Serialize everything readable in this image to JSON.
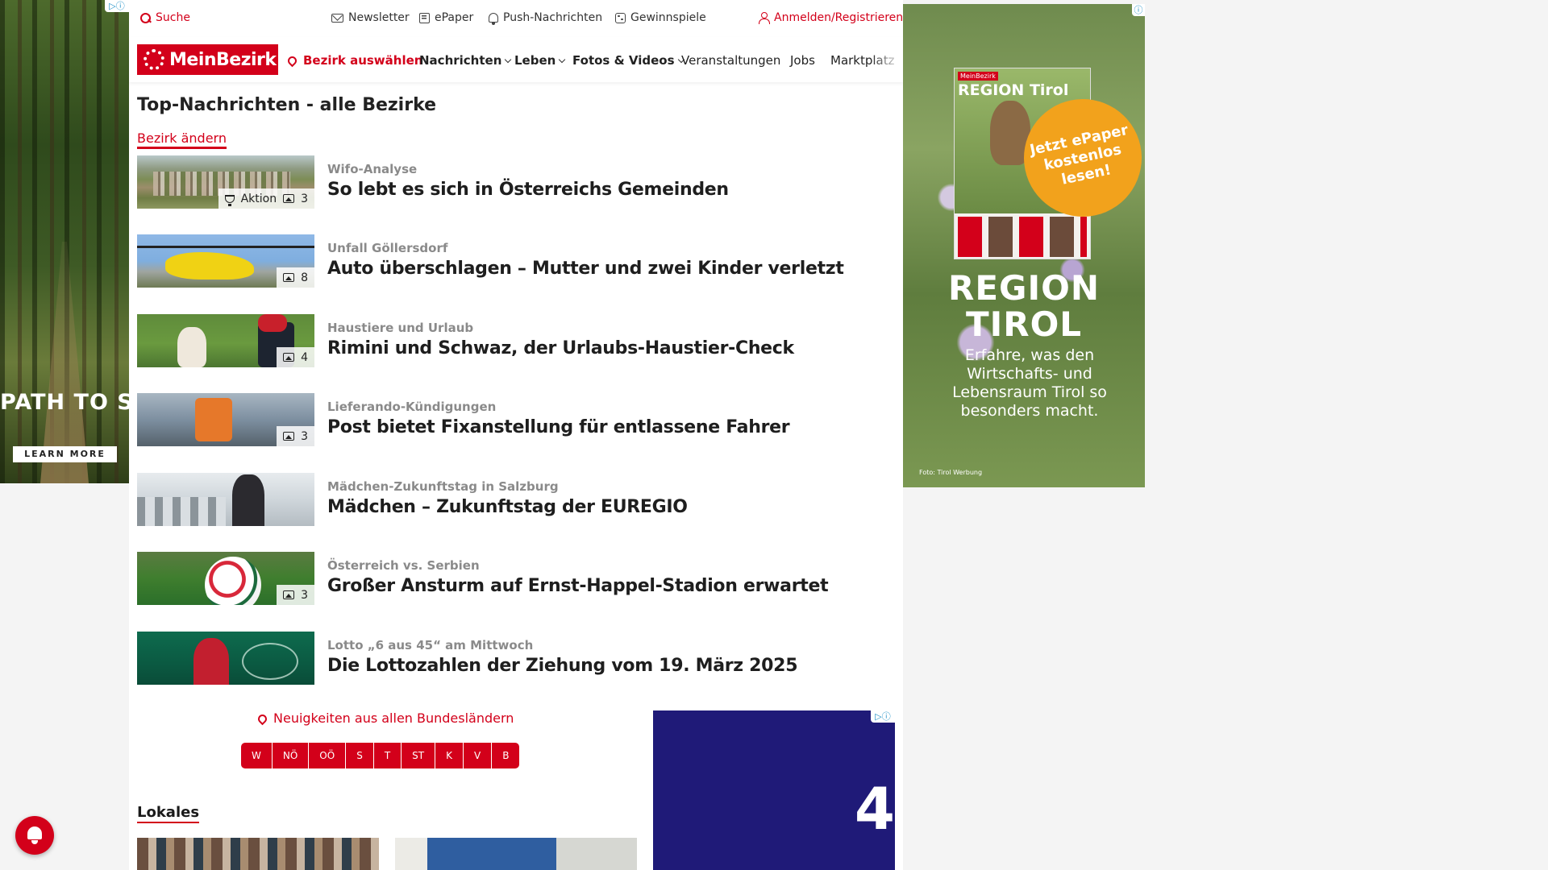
{
  "ads": {
    "left": {
      "headline": "PATH TO SUCCESS",
      "cta": "LEARN MORE",
      "choice": "▷ⓘ"
    },
    "right": {
      "magazine_label": "MeinBezirk",
      "magazine_title": "REGION Tirol",
      "promo": "Jetzt ePaper kostenlos lesen!",
      "headline": "REGION TIROL",
      "description": "Erfahre, was den Wirtschafts- und Lebensraum Tirol so besonders macht.",
      "credit": "Foto: Tirol Werbung",
      "choice": "ⓘ"
    },
    "bottom": {
      "choice": "▷ⓘ",
      "number": "4"
    }
  },
  "topbar": {
    "search": "Suche",
    "newsletter": "Newsletter",
    "epaper": "ePaper",
    "push": "Push-Nachrichten",
    "games": "Gewinnspiele",
    "login": "Anmelden/Registrieren"
  },
  "nav": {
    "logo": "MeinBezirk",
    "district": "Bezirk auswählen",
    "items": [
      "Nachrichten",
      "Leben",
      "Fotos & Videos",
      "Veranstaltungen",
      "Jobs",
      "Marktplatz"
    ]
  },
  "section": {
    "title": "Top-Nachrichten - alle Bezirke",
    "change_link": "Bezirk ändern"
  },
  "articles": [
    {
      "kicker": "Wifo-Analyse",
      "headline": "So lebt es sich in Österreichs Gemeinden",
      "tag": "Aktion",
      "images": "3"
    },
    {
      "kicker": "Unfall Göllersdorf",
      "headline": "Auto überschlagen – Mutter und zwei Kinder verletzt",
      "images": "8"
    },
    {
      "kicker": "Haustiere und Urlaub",
      "headline": "Rimini und Schwaz, der Urlaubs-Haustier-Check",
      "images": "4"
    },
    {
      "kicker": "Lieferando-Kündigungen",
      "headline": "Post bietet Fixanstellung für entlassene Fahrer",
      "images": "3"
    },
    {
      "kicker": "Mädchen-Zukunftstag in Salzburg",
      "headline": "Mädchen – Zukunftstag der EUREGIO"
    },
    {
      "kicker": "Österreich vs. Serbien",
      "headline": "Großer Ansturm auf Ernst-Happel-Stadion erwartet",
      "images": "3"
    },
    {
      "kicker": "Lotto „6 aus 45“ am Mittwoch",
      "headline": "Die Lottozahlen der Ziehung vom 19. März 2025"
    }
  ],
  "bundeslaender": {
    "label": "Neuigkeiten aus allen Bundesländern",
    "states": [
      "W",
      "NÖ",
      "OÖ",
      "S",
      "T",
      "ST",
      "K",
      "V",
      "B"
    ]
  },
  "lokales": {
    "title": "Lokales"
  },
  "colors": {
    "brand": "#d3001a",
    "text": "#1e1e1e",
    "kicker": "#8a8a8a"
  }
}
